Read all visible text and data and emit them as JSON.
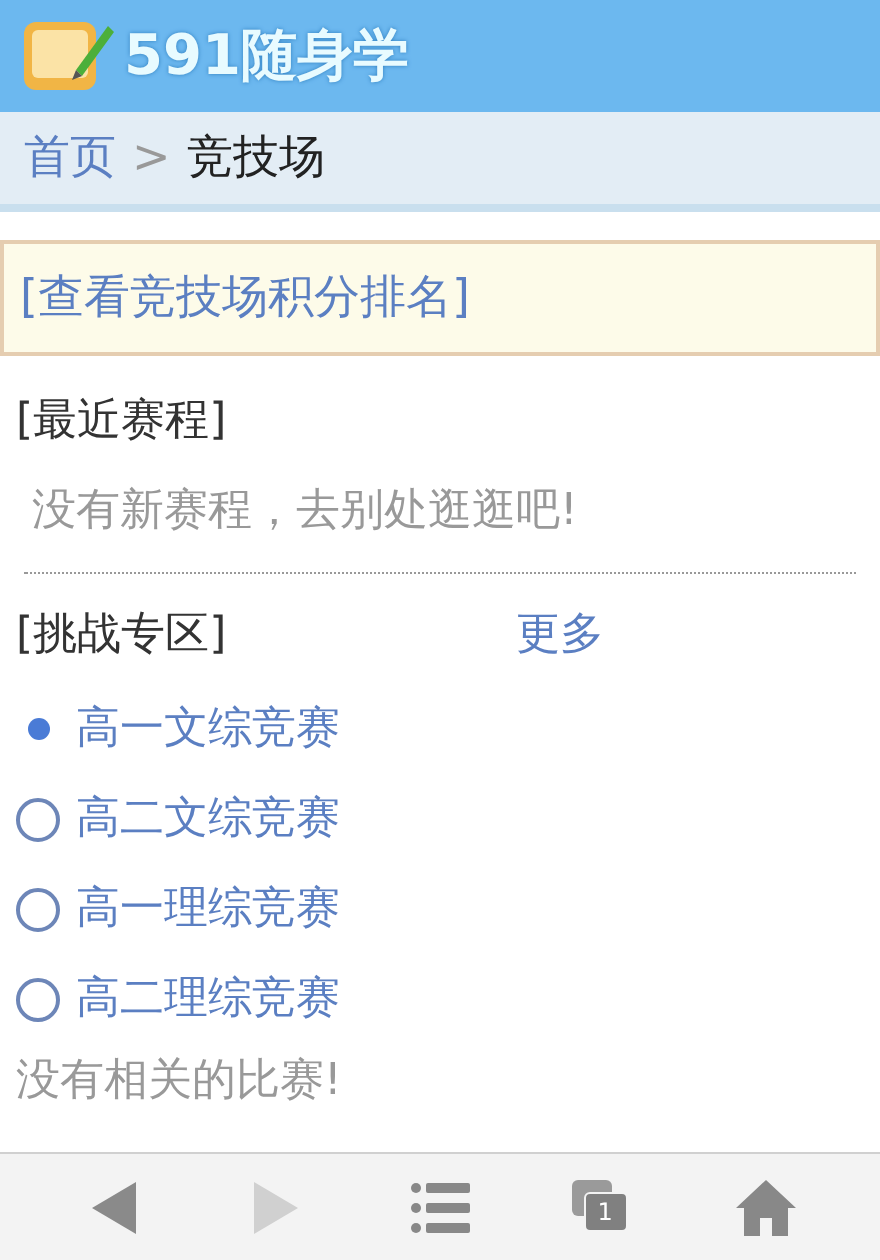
{
  "header": {
    "title": "591随身学"
  },
  "breadcrumb": {
    "home": "首页",
    "separator": ">",
    "current": "竞技场"
  },
  "ranking_link": "[查看竞技场积分排名]",
  "recent": {
    "heading": "[最近赛程]",
    "empty_text": "没有新赛程，去别处逛逛吧!"
  },
  "challenge": {
    "heading": "[挑战专区]",
    "more": "更多",
    "items": [
      {
        "label": "高一文综竞赛",
        "selected": true
      },
      {
        "label": "高二文综竞赛",
        "selected": false
      },
      {
        "label": "高一理综竞赛",
        "selected": false
      },
      {
        "label": "高二理综竞赛",
        "selected": false
      }
    ],
    "empty_text": "没有相关的比赛!"
  },
  "toolbar": {
    "back_disabled": false,
    "forward_disabled": true,
    "tab_count": "1"
  }
}
